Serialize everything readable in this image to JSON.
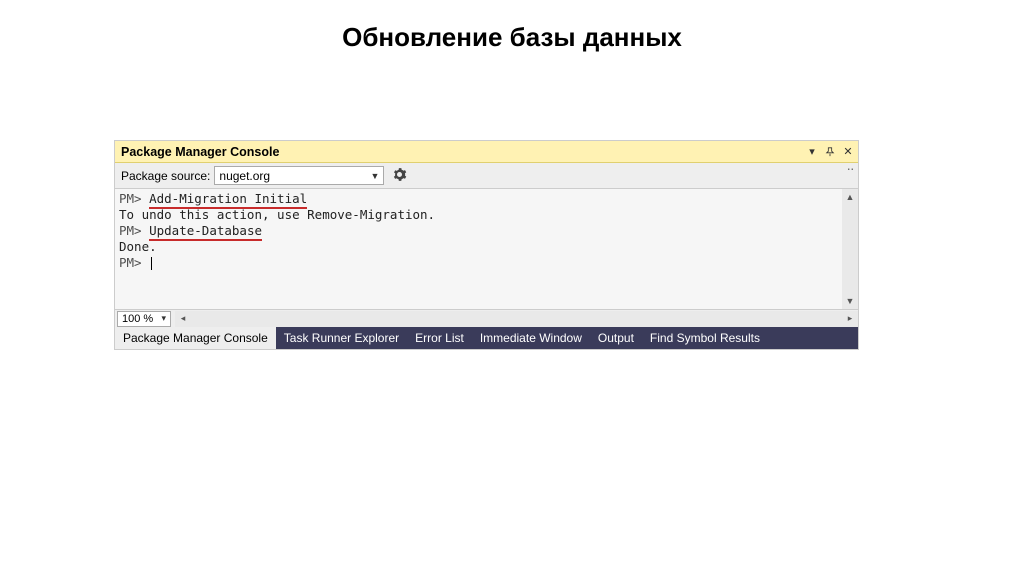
{
  "page_heading": "Обновление базы данных",
  "panel": {
    "title": "Package Manager Console",
    "toolbar": {
      "source_label": "Package source:",
      "source_value": "nuget.org"
    },
    "console": {
      "lines": [
        {
          "prompt": "PM>",
          "cmd": "Add-Migration Initial",
          "underlined": true
        },
        {
          "text": "To undo this action, use Remove-Migration."
        },
        {
          "prompt": "PM>",
          "cmd": "Update-Database",
          "underlined": true
        },
        {
          "text": "Done."
        },
        {
          "prompt": "PM>",
          "caret": true
        }
      ]
    },
    "zoom": "100 %",
    "tabs": [
      "Package Manager Console",
      "Task Runner Explorer",
      "Error List",
      "Immediate Window",
      "Output",
      "Find Symbol Results"
    ],
    "active_tab_index": 0
  }
}
